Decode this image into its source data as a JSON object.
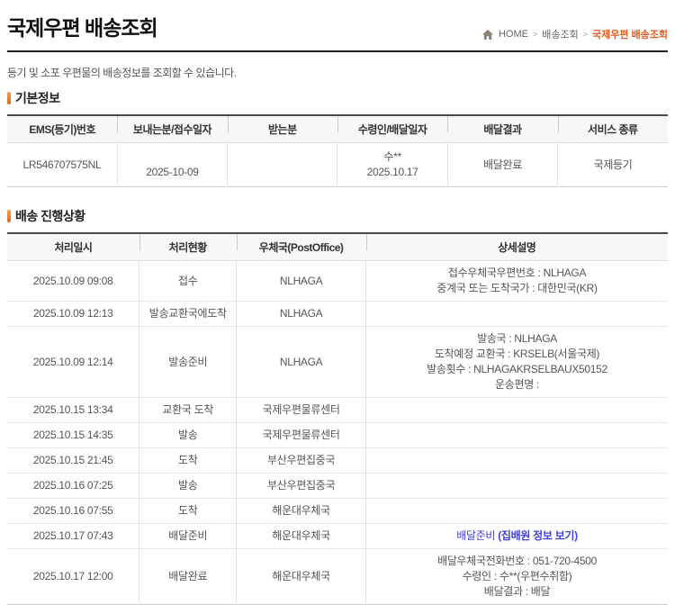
{
  "page": {
    "title": "국제우편 배송조회",
    "subtitle": "등기 및 소포 우편물의 배송정보를 조회할 수 있습니다."
  },
  "breadcrumb": {
    "home": "HOME",
    "level1": "배송조회",
    "current": "국제우편 배송조회"
  },
  "colors": {
    "accent_orange": "#e8630a",
    "breadcrumb_active": "#e25b21",
    "link_blue": "#4242d9",
    "table_top_border": "#4a4a4a"
  },
  "icons": {
    "home": "home-icon"
  },
  "basic_info": {
    "section_title": "기본정보",
    "headers": [
      "EMS(등기)번호",
      "보내는분/접수일자",
      "받는분",
      "수령인/배달일자",
      "배달결과",
      "서비스 종류"
    ],
    "row": {
      "ems_number": "LR546707575NL",
      "sender_name": "",
      "sender_date": "2025-10-09",
      "receiver": "",
      "recipient_name": "수**",
      "delivery_date": "2025.10.17",
      "delivery_result": "배달완료",
      "service_type": "국제등기"
    }
  },
  "progress": {
    "section_title": "배송 진행상황",
    "headers": [
      "처리일시",
      "처리현황",
      "우체국(PostOffice)",
      "상세설명"
    ],
    "col_widths": [
      "20%",
      "14.7%",
      "19.6%",
      "45.7%"
    ],
    "rows": [
      {
        "datetime": "2025.10.09 09:08",
        "status": "접수",
        "office": "NLHAGA",
        "detail_lines": [
          "접수우체국우편번호 : NLHAGA",
          "중계국 또는 도착국가 : 대한민국(KR)"
        ]
      },
      {
        "datetime": "2025.10.09 12:13",
        "status": "발송교환국에도착",
        "office": "NLHAGA",
        "detail_lines": []
      },
      {
        "datetime": "2025.10.09 12:14",
        "status": "발송준비",
        "office": "NLHAGA",
        "detail_lines": [
          "발송국 : NLHAGA",
          "도착예정 교환국 : KRSELB(서울국제)",
          "발송횟수 : NLHAGAKRSELBAUX50152",
          "운송편명 :"
        ]
      },
      {
        "datetime": "2025.10.15 13:34",
        "status": "교환국 도착",
        "office": "국제우편물류센터",
        "detail_lines": []
      },
      {
        "datetime": "2025.10.15 14:35",
        "status": "발송",
        "office": "국제우편물류센터",
        "detail_lines": []
      },
      {
        "datetime": "2025.10.15 21:45",
        "status": "도착",
        "office": "부산우편집중국",
        "detail_lines": []
      },
      {
        "datetime": "2025.10.16 07:25",
        "status": "발송",
        "office": "부산우편집중국",
        "detail_lines": []
      },
      {
        "datetime": "2025.10.16 07:55",
        "status": "도착",
        "office": "해운대우체국",
        "detail_lines": []
      },
      {
        "datetime": "2025.10.17 07:43",
        "status": "배달준비",
        "office": "해운대우체국",
        "detail_prefix": "배달준비 ",
        "detail_link": "(집배원 정보 보기)",
        "detail_lines": []
      },
      {
        "datetime": "2025.10.17 12:00",
        "status": "배달완료",
        "office": "해운대우체국",
        "detail_lines": [
          "배달우체국전화번호 : 051-720-4500",
          "수령인 : 수**(우편수취함)",
          "배달결과 : 배달"
        ]
      }
    ]
  }
}
